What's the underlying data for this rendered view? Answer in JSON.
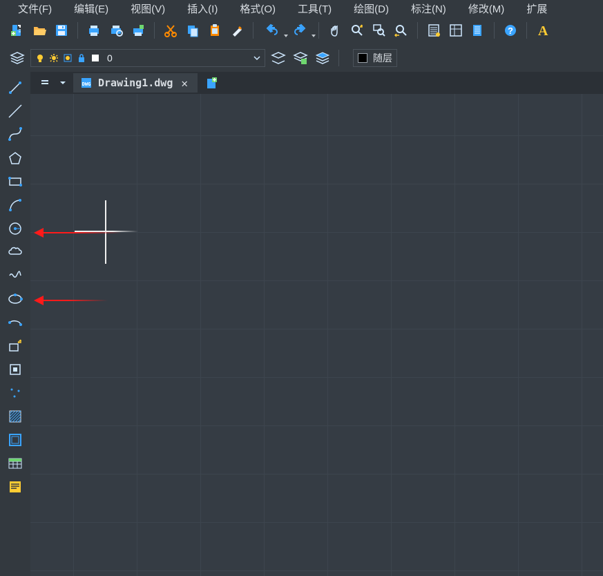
{
  "menu": {
    "file": "文件(F)",
    "edit": "编辑(E)",
    "view": "视图(V)",
    "insert": "插入(I)",
    "format": "格式(O)",
    "tools": "工具(T)",
    "draw": "绘图(D)",
    "dimension": "标注(N)",
    "modify": "修改(M)",
    "extend": "扩展"
  },
  "layer": {
    "current_name": "0",
    "bylayer_label": "随层"
  },
  "tabs": {
    "file_name": "Drawing1.dwg",
    "close_glyph": "✕"
  },
  "icons": {
    "new_doc": "new-document-icon",
    "open": "folder-open-icon",
    "save": "save-icon",
    "print": "print-icon",
    "print_preview": "print-preview-icon",
    "plot": "plot-icon",
    "cut": "cut-icon",
    "copy": "copy-icon",
    "paste": "paste-icon",
    "eraser": "eraser-icon",
    "undo": "undo-icon",
    "redo": "redo-icon",
    "pan": "pan-hand-icon",
    "zoom_realtime": "zoom-realtime-icon",
    "zoom_window": "zoom-window-icon",
    "zoom_prev": "zoom-previous-icon",
    "properties": "properties-icon",
    "table": "table-icon",
    "sheet": "sheet-icon",
    "help": "help-icon",
    "text": "text-tool-icon",
    "layer_manager": "layer-manager-icon",
    "bulb": "lightbulb-icon",
    "sun": "sun-freeze-icon",
    "sun_vp": "sun-viewport-icon",
    "lock": "lock-icon",
    "lineweight": "lineweight-square-icon",
    "layer_walk": "layer-walk-icon",
    "layer_state": "layer-state-icon",
    "layer_iso": "layer-isolate-icon",
    "line": "line-tool-icon",
    "pline": "polyline-tool-icon",
    "arc": "arc-tool-icon",
    "polygon": "polygon-tool-icon",
    "rectangle": "rectangle-tool-icon",
    "arc3p": "arc-3pt-tool-icon",
    "circle": "circle-tool-icon",
    "cloud": "revision-cloud-icon",
    "spline": "spline-tool-icon",
    "ellipse": "ellipse-tool-icon",
    "ellipse_arc": "ellipse-arc-tool-icon",
    "insert_block": "insert-block-icon",
    "make_block": "make-block-icon",
    "point": "point-tool-icon",
    "hatch": "hatch-tool-icon",
    "region": "region-tool-icon",
    "tablegrid": "table-grid-icon",
    "mtext": "multiline-text-icon"
  },
  "colors": {
    "accent_blue": "#3aa4ff",
    "accent_yellow": "#ffcc33",
    "accent_orange": "#ff8a00",
    "arrow_red": "#ff1a1a"
  }
}
